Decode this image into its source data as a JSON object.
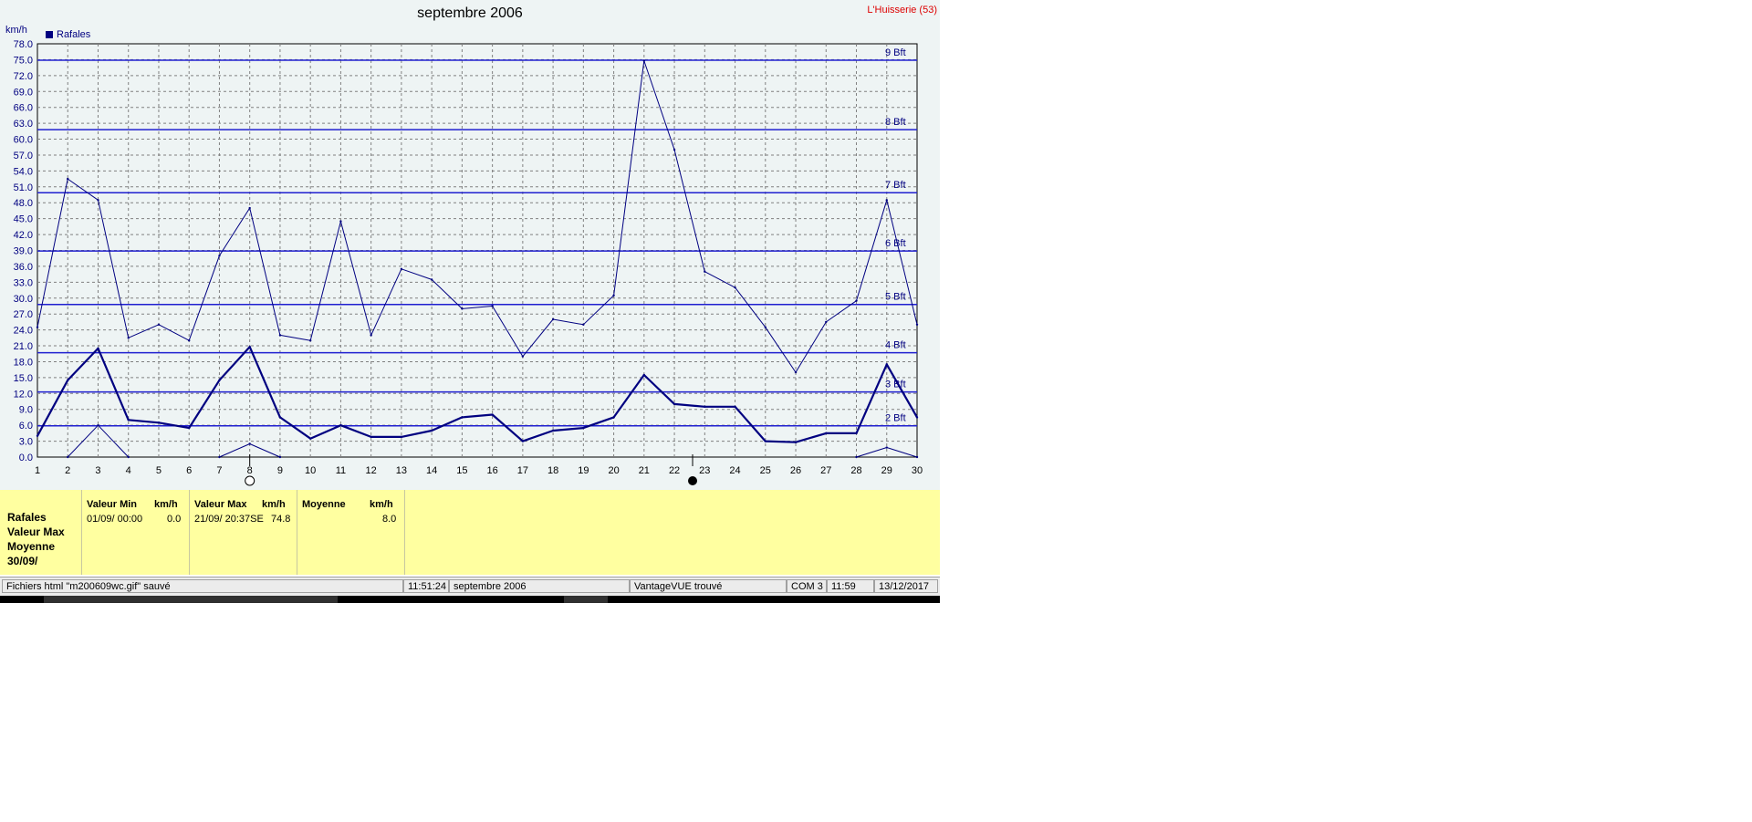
{
  "header": {
    "title": "septembre 2006",
    "station": "L'Huisserie (53)",
    "unit": "km/h",
    "legend_label": "Rafales"
  },
  "colors": {
    "series": "#000080",
    "beaufort_line": "#2020d0",
    "background": "#eef4f4",
    "info_panel": "#ffffa0",
    "station_text": "#dd0000"
  },
  "moon_icons": [
    "full-moon-icon",
    "new-moon-icon"
  ],
  "chart_data": {
    "type": "line",
    "title": "septembre 2006",
    "ylabel": "km/h",
    "ylim": [
      0,
      78
    ],
    "ytick_step": 3,
    "ytick_labels": [
      "0.0",
      "3.0",
      "6.0",
      "9.0",
      "12.0",
      "15.0",
      "18.0",
      "21.0",
      "24.0",
      "27.0",
      "30.0",
      "33.0",
      "36.0",
      "39.0",
      "42.0",
      "45.0",
      "48.0",
      "51.0",
      "54.0",
      "57.0",
      "60.0",
      "63.0",
      "66.0",
      "69.0",
      "72.0",
      "75.0",
      "78.0"
    ],
    "x": [
      1,
      2,
      3,
      4,
      5,
      6,
      7,
      8,
      9,
      10,
      11,
      12,
      13,
      14,
      15,
      16,
      17,
      18,
      19,
      20,
      21,
      22,
      23,
      24,
      25,
      26,
      27,
      28,
      29,
      30
    ],
    "grid": true,
    "legend": "top-left",
    "series": [
      {
        "name": "Rafales",
        "style": "max",
        "values": [
          24.5,
          52.5,
          48.5,
          22.5,
          25.0,
          22.0,
          38.0,
          47.0,
          23.0,
          22.0,
          44.5,
          23.0,
          35.5,
          33.5,
          28.0,
          28.5,
          19.0,
          26.0,
          25.0,
          30.5,
          74.8,
          58.0,
          35.0,
          32.0,
          24.5,
          16.0,
          25.5,
          29.5,
          48.5,
          25.0
        ]
      },
      {
        "style": "mean",
        "values": [
          4.0,
          14.5,
          20.5,
          7.0,
          6.5,
          5.5,
          14.5,
          20.8,
          7.5,
          3.5,
          6.0,
          3.8,
          3.8,
          5.0,
          7.5,
          8.0,
          3.0,
          5.0,
          5.5,
          7.5,
          15.5,
          10.0,
          9.5,
          9.5,
          3.0,
          2.8,
          4.5,
          4.5,
          17.5,
          7.5
        ]
      },
      {
        "style": "min",
        "values": [
          null,
          0.0,
          6.0,
          0.0,
          null,
          null,
          0.0,
          2.5,
          0.0,
          null,
          null,
          null,
          null,
          null,
          null,
          null,
          null,
          null,
          null,
          null,
          null,
          null,
          null,
          null,
          null,
          null,
          null,
          0.0,
          1.8,
          0.0
        ]
      }
    ],
    "beaufort": [
      {
        "label": "2 Bft",
        "value": 5.9
      },
      {
        "label": "3 Bft",
        "value": 12.3
      },
      {
        "label": "4 Bft",
        "value": 19.7
      },
      {
        "label": "5 Bft",
        "value": 28.8
      },
      {
        "label": "6 Bft",
        "value": 38.9
      },
      {
        "label": "7 Bft",
        "value": 49.9
      },
      {
        "label": "8 Bft",
        "value": 61.8
      },
      {
        "label": "9 Bft",
        "value": 74.9
      }
    ],
    "markers": [
      {
        "x": 8,
        "icon": "full-moon-icon"
      },
      {
        "x": 22.6,
        "icon": "new-moon-icon"
      }
    ]
  },
  "info": {
    "left_labels": [
      "Rafales",
      "Valeur Max",
      "Moyenne",
      "30/09/"
    ],
    "min": {
      "header": "Valeur Min",
      "unit": "km/h",
      "date": "01/09/  00:00",
      "value": "0.0"
    },
    "max": {
      "header": "Valeur Max",
      "unit": "km/h",
      "date": "21/09/  20:37SE",
      "value": "74.8"
    },
    "avg": {
      "header": "Moyenne",
      "unit": "km/h",
      "value": "8.0"
    }
  },
  "status": {
    "message": "Fichiers html  \"m200609wc.gif\"  sauvé",
    "time1": "11:51:24",
    "period": "septembre 2006",
    "station": "VantageVUE trouvé",
    "port": "COM 3",
    "time2": "11:59",
    "date": "13/12/2017"
  }
}
